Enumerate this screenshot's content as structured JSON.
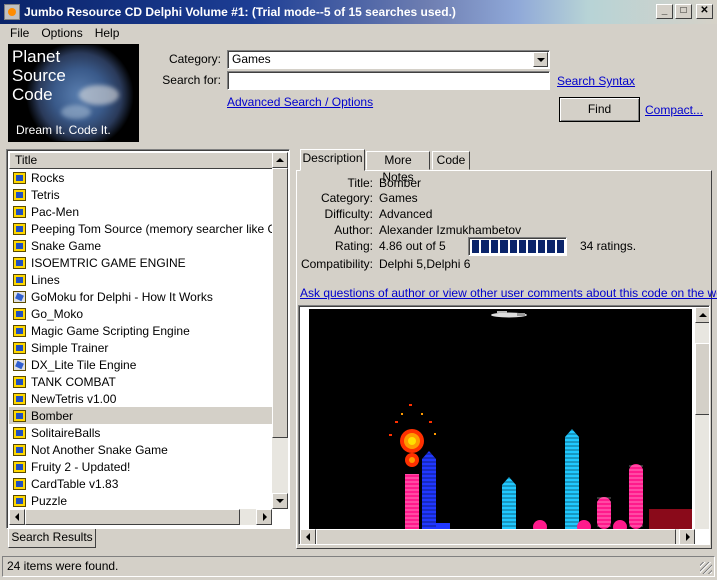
{
  "window": {
    "title": "Jumbo Resource CD Delphi Volume #1: (Trial mode--5 of 15 searches used.)",
    "min_glyph": "_",
    "max_glyph": "□",
    "close_glyph": "✕"
  },
  "menu": {
    "items": [
      {
        "label": "File"
      },
      {
        "label": "Options"
      },
      {
        "label": "Help"
      }
    ]
  },
  "logo": {
    "line1": "Planet",
    "line2": "Source",
    "line3": "Code",
    "tagline": "Dream It.  Code It."
  },
  "search": {
    "category_label": "Category:",
    "category_value": "Games",
    "search_for_label": "Search for:",
    "search_for_value": "",
    "search_syntax_link": "Search Syntax",
    "advanced_link": "Advanced Search / Options",
    "find_button": "Find",
    "compact_link": "Compact..."
  },
  "results": {
    "column_header": "Title",
    "items": [
      {
        "title": "Rocks",
        "icon": "vb-code-icon"
      },
      {
        "title": "Tetris",
        "icon": "vb-code-icon"
      },
      {
        "title": "Pac-Men",
        "icon": "vb-code-icon"
      },
      {
        "title": "Peeping Tom Source (memory searcher like GAME",
        "icon": "vb-code-icon"
      },
      {
        "title": "Snake Game",
        "icon": "vb-code-icon"
      },
      {
        "title": "ISOEMTRIC GAME ENGINE",
        "icon": "vb-code-icon"
      },
      {
        "title": "Lines",
        "icon": "vb-code-icon"
      },
      {
        "title": "GoMoku for Delphi - How It Works",
        "icon": "article-icon"
      },
      {
        "title": "Go_Moko",
        "icon": "vb-code-icon"
      },
      {
        "title": "Magic Game Scripting Engine",
        "icon": "vb-code-icon"
      },
      {
        "title": "Simple Trainer",
        "icon": "vb-code-icon"
      },
      {
        "title": "DX_Lite Tile Engine",
        "icon": "dx-icon"
      },
      {
        "title": "TANK COMBAT",
        "icon": "vb-code-icon"
      },
      {
        "title": "NewTetris v1.00",
        "icon": "vb-code-icon"
      },
      {
        "title": "Bomber",
        "icon": "vb-code-icon",
        "selected": true
      },
      {
        "title": "SolitaireBalls",
        "icon": "vb-code-icon"
      },
      {
        "title": "Not Another Snake Game",
        "icon": "vb-code-icon"
      },
      {
        "title": "Fruity 2 - Updated!",
        "icon": "vb-code-icon"
      },
      {
        "title": "CardTable v1.83",
        "icon": "vb-code-icon"
      },
      {
        "title": "Puzzle",
        "icon": "vb-code-icon"
      }
    ],
    "bottom_tab": "Search Results"
  },
  "details": {
    "tabs": [
      {
        "label": "Description",
        "active": true
      },
      {
        "label": "More Notes",
        "active": false
      },
      {
        "label": "Code",
        "active": false
      }
    ],
    "fields": {
      "title_label": "Title:",
      "title_value": "Bomber",
      "category_label": "Category:",
      "category_value": "Games",
      "difficulty_label": "Difficulty:",
      "difficulty_value": "Advanced",
      "author_label": "Author:",
      "author_value": "Alexander Izmukhambetov",
      "rating_label": "Rating:",
      "rating_value": "4.86 out of 5",
      "rating_fraction": 0.972,
      "rating_count": "34 ratings.",
      "compat_label": "Compatibility:",
      "compat_value": "Delphi 5,Delphi 6"
    },
    "comments_link": "Ask questions of author or view other user comments about this code on the web..."
  },
  "status": {
    "text": "24 items were found."
  },
  "colors": {
    "titlebar_start": "#0a246a",
    "link": "#0000cc",
    "window_bg": "#d4d0c8"
  }
}
